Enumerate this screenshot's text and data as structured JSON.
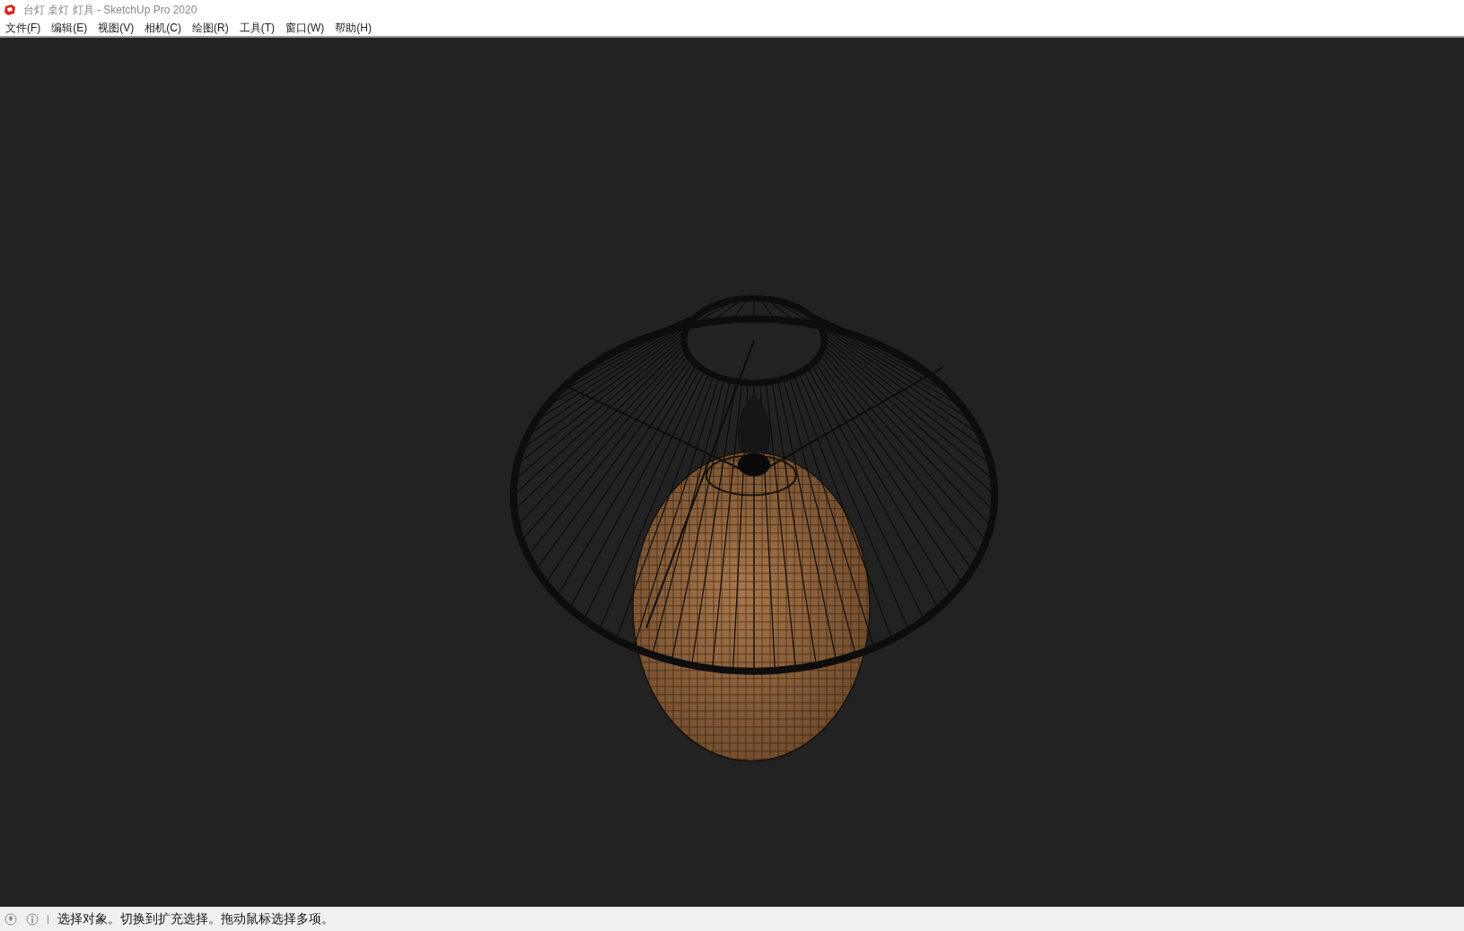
{
  "window": {
    "title": "台灯 桌灯 灯具 - SketchUp Pro 2020"
  },
  "menu": [
    "文件(F)",
    "编辑(E)",
    "视图(V)",
    "相机(C)",
    "绘图(R)",
    "工具(T)",
    "窗口(W)",
    "帮助(H)"
  ],
  "status_bar": {
    "message": "选择对象。切换到扩充选择。拖动鼠标选择多项。"
  }
}
